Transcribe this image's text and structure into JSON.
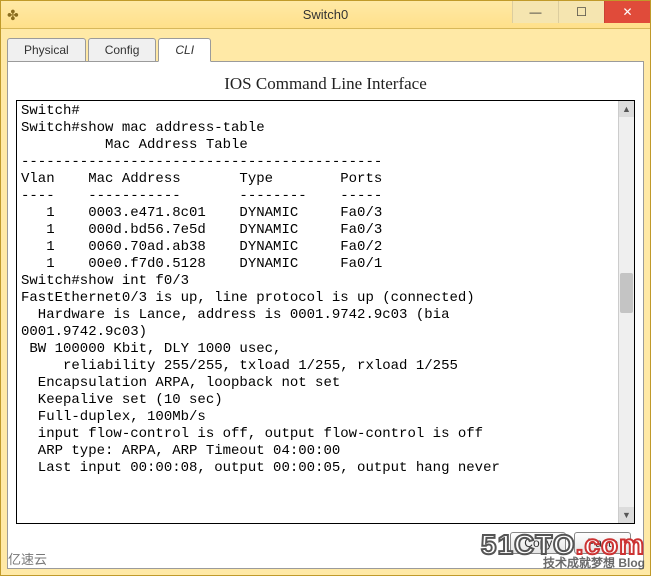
{
  "window": {
    "title": "Switch0",
    "buttons": {
      "min": "—",
      "max": "☐",
      "close": "✕"
    }
  },
  "tabs": [
    {
      "label": "Physical",
      "active": false
    },
    {
      "label": "Config",
      "active": false
    },
    {
      "label": "CLI",
      "active": true
    }
  ],
  "page_title": "IOS Command Line Interface",
  "terminal_lines": [
    "Switch#",
    "Switch#show mac address-table",
    "          Mac Address Table",
    "-------------------------------------------",
    "",
    "Vlan    Mac Address       Type        Ports",
    "----    -----------       --------    -----",
    "",
    "   1    0003.e471.8c01    DYNAMIC     Fa0/3",
    "   1    000d.bd56.7e5d    DYNAMIC     Fa0/3",
    "   1    0060.70ad.ab38    DYNAMIC     Fa0/2",
    "   1    00e0.f7d0.5128    DYNAMIC     Fa0/1",
    "Switch#show int f0/3",
    "FastEthernet0/3 is up, line protocol is up (connected)",
    "  Hardware is Lance, address is 0001.9742.9c03 (bia",
    "0001.9742.9c03)",
    " BW 100000 Kbit, DLY 1000 usec,",
    "     reliability 255/255, txload 1/255, rxload 1/255",
    "  Encapsulation ARPA, loopback not set",
    "  Keepalive set (10 sec)",
    "  Full-duplex, 100Mb/s",
    "  input flow-control is off, output flow-control is off",
    "  ARP type: ARPA, ARP Timeout 04:00:00",
    "  Last input 00:00:08, output 00:00:05, output hang never"
  ],
  "buttons": {
    "copy": "Copy",
    "paste": "Paste"
  },
  "watermark": {
    "main_a": "51CTO",
    "main_b": ".com",
    "sub": "技术成就梦想   Blog"
  },
  "corner": "亿速云"
}
